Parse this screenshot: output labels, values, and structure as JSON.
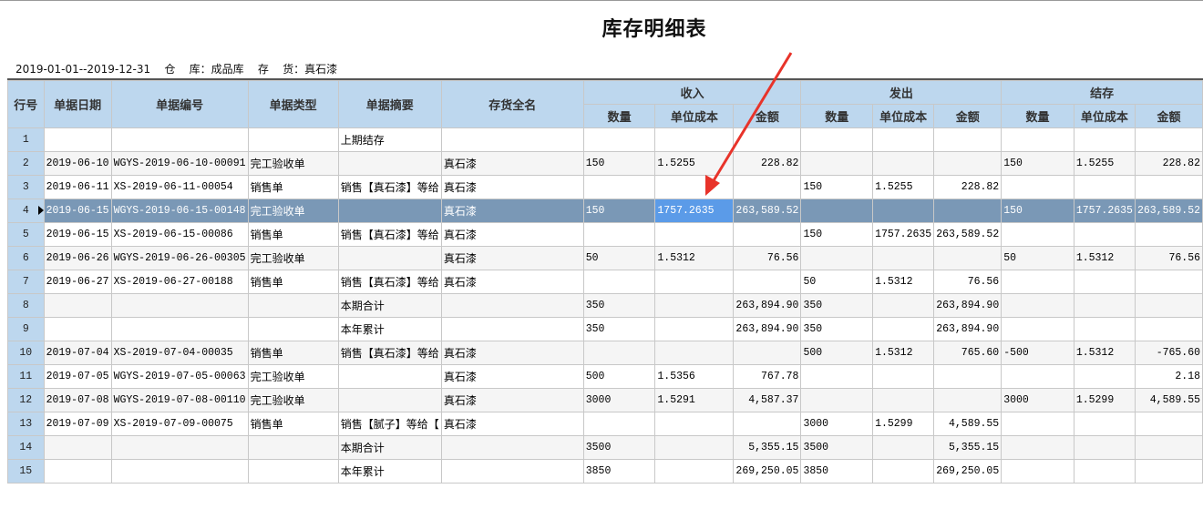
{
  "title": "库存明细表",
  "filters": "2019-01-01--2019-12-31    仓    库：成品库    存    货：真石漆",
  "headers": {
    "row_no": "行号",
    "date": "单据日期",
    "doc_no": "单据编号",
    "doc_type": "单据类型",
    "summary": "单据摘要",
    "item": "存货全名",
    "income": "收入",
    "issue": "发出",
    "balance": "结存",
    "qty": "数量",
    "unit_cost": "单位成本",
    "amount": "金额"
  },
  "rows": [
    {
      "no": "1",
      "cells": [
        "",
        "",
        "",
        "上期结存",
        "",
        "",
        "",
        "",
        "",
        "",
        "",
        "",
        "",
        "",
        ""
      ]
    },
    {
      "no": "2",
      "cells": [
        "2019-06-10",
        "WGYS-2019-06-10-00091",
        "完工验收单",
        "",
        "真石漆",
        "150",
        "1.5255",
        "228.82",
        "",
        "",
        "",
        "150",
        "1.5255",
        "228.82"
      ]
    },
    {
      "no": "3",
      "cells": [
        "2019-06-11",
        "XS-2019-06-11-00054",
        "销售单",
        "销售【真石漆】等给",
        "真石漆",
        "",
        "",
        "",
        "150",
        "1.5255",
        "228.82",
        "",
        "",
        ""
      ]
    },
    {
      "no": "4",
      "cells": [
        "2019-06-15",
        "WGYS-2019-06-15-00148",
        "完工验收单",
        "",
        "真石漆",
        "150",
        "1757.2635",
        "263,589.52",
        "",
        "",
        "",
        "150",
        "1757.2635",
        "263,589.52"
      ]
    },
    {
      "no": "5",
      "cells": [
        "2019-06-15",
        "XS-2019-06-15-00086",
        "销售单",
        "销售【真石漆】等给",
        "真石漆",
        "",
        "",
        "",
        "150",
        "1757.2635",
        "263,589.52",
        "",
        "",
        ""
      ]
    },
    {
      "no": "6",
      "cells": [
        "2019-06-26",
        "WGYS-2019-06-26-00305",
        "完工验收单",
        "",
        "真石漆",
        "50",
        "1.5312",
        "76.56",
        "",
        "",
        "",
        "50",
        "1.5312",
        "76.56"
      ]
    },
    {
      "no": "7",
      "cells": [
        "2019-06-27",
        "XS-2019-06-27-00188",
        "销售单",
        "销售【真石漆】等给",
        "真石漆",
        "",
        "",
        "",
        "50",
        "1.5312",
        "76.56",
        "",
        "",
        ""
      ]
    },
    {
      "no": "8",
      "cells": [
        "",
        "",
        "",
        "本期合计",
        "",
        "350",
        "",
        "263,894.90",
        "350",
        "",
        "263,894.90",
        "",
        "",
        ""
      ]
    },
    {
      "no": "9",
      "cells": [
        "",
        "",
        "",
        "本年累计",
        "",
        "350",
        "",
        "263,894.90",
        "350",
        "",
        "263,894.90",
        "",
        "",
        ""
      ]
    },
    {
      "no": "10",
      "cells": [
        "2019-07-04",
        "XS-2019-07-04-00035",
        "销售单",
        "销售【真石漆】等给",
        "真石漆",
        "",
        "",
        "",
        "500",
        "1.5312",
        "765.60",
        "-500",
        "1.5312",
        "-765.60"
      ]
    },
    {
      "no": "11",
      "cells": [
        "2019-07-05",
        "WGYS-2019-07-05-00063",
        "完工验收单",
        "",
        "真石漆",
        "500",
        "1.5356",
        "767.78",
        "",
        "",
        "",
        "",
        "",
        "2.18"
      ]
    },
    {
      "no": "12",
      "cells": [
        "2019-07-08",
        "WGYS-2019-07-08-00110",
        "完工验收单",
        "",
        "真石漆",
        "3000",
        "1.5291",
        "4,587.37",
        "",
        "",
        "",
        "3000",
        "1.5299",
        "4,589.55"
      ]
    },
    {
      "no": "13",
      "cells": [
        "2019-07-09",
        "XS-2019-07-09-00075",
        "销售单",
        "销售【腻子】等给【",
        "真石漆",
        "",
        "",
        "",
        "3000",
        "1.5299",
        "4,589.55",
        "",
        "",
        ""
      ]
    },
    {
      "no": "14",
      "cells": [
        "",
        "",
        "",
        "本期合计",
        "",
        "3500",
        "",
        "5,355.15",
        "3500",
        "",
        "5,355.15",
        "",
        "",
        ""
      ]
    },
    {
      "no": "15",
      "cells": [
        "",
        "",
        "",
        "本年累计",
        "",
        "3850",
        "",
        "269,250.05",
        "3850",
        "",
        "269,250.05",
        "",
        "",
        ""
      ]
    }
  ],
  "selected_row": "4",
  "colors": {
    "header": "#bdd7ee",
    "selected": "#7a98b6",
    "focus": "#5b9be8",
    "arrow": "#e8332a"
  }
}
